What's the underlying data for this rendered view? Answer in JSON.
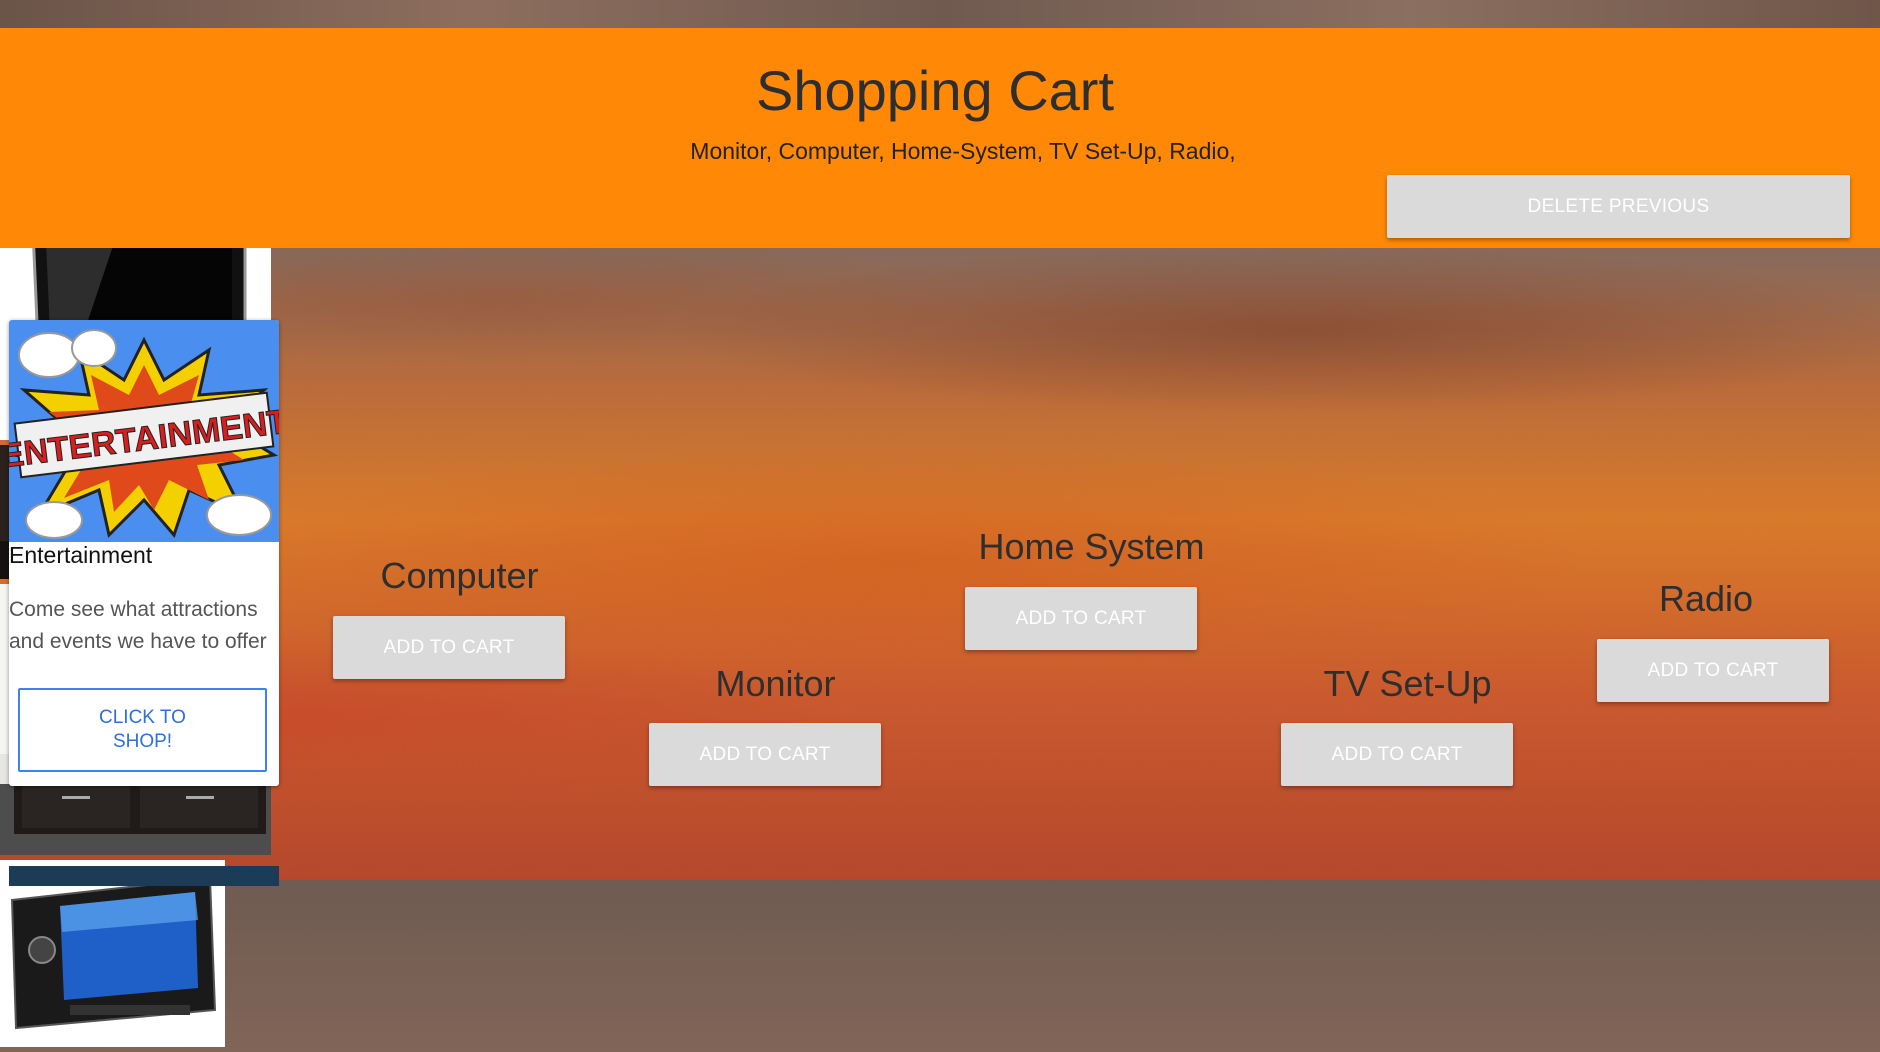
{
  "header": {
    "title": "Shopping Cart",
    "cart_contents": "Monitor, Computer, Home-System, TV Set-Up, Radio,",
    "delete_label": "DELETE PREVIOUS"
  },
  "promo": {
    "image_text": "ENTERTAINMENT",
    "title": "Entertainment",
    "description": "Come see what attractions and events we have to offer",
    "button_label": "CLICK TO SHOP!"
  },
  "products": [
    {
      "name": "Computer",
      "button": "ADD TO CART",
      "icon": "laptop-image"
    },
    {
      "name": "Monitor",
      "button": "ADD TO CART",
      "icon": "monitor-image"
    },
    {
      "name": "Home System",
      "button": "ADD TO CART",
      "icon": "home-theater-image"
    },
    {
      "name": "TV Set-Up",
      "button": "ADD TO CART",
      "icon": "tv-stand-image"
    },
    {
      "name": "Radio",
      "button": "ADD TO CART",
      "icon": "car-radio-image"
    }
  ],
  "colors": {
    "header": "#ff8806",
    "button": "#dadada",
    "link": "#2f6fe0"
  }
}
